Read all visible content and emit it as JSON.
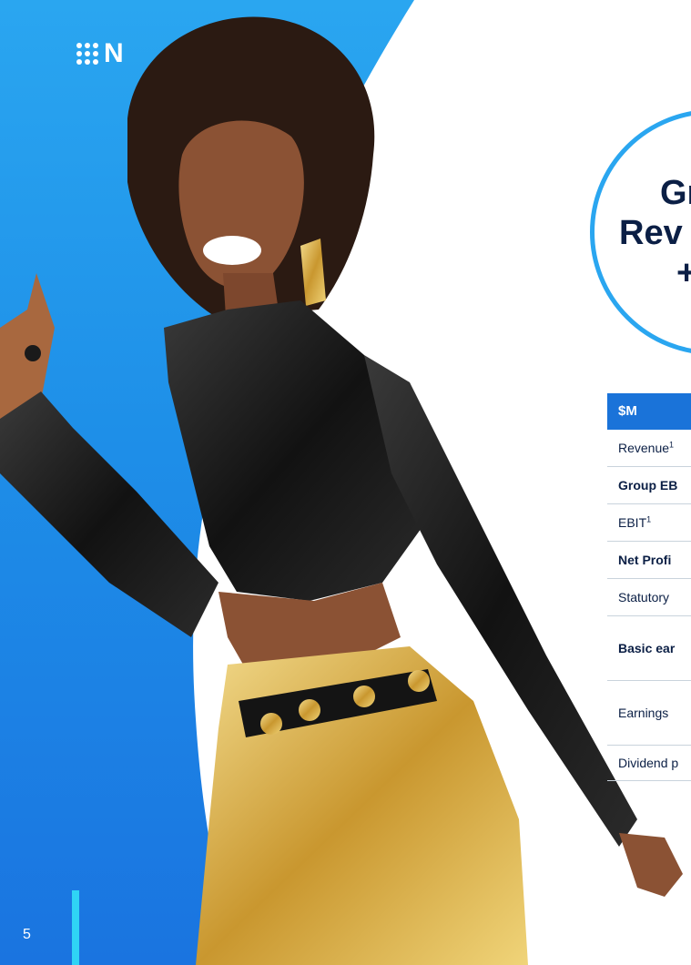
{
  "logo": {
    "text": "N",
    "icon": "nine-dots-logo-icon"
  },
  "callout": {
    "line1": "Gr",
    "line2": "Rev",
    "line3": "+"
  },
  "table": {
    "header": "$M",
    "rows": [
      {
        "label": "Revenue",
        "sup": "1",
        "bold": false
      },
      {
        "label": "Group EB",
        "sup": "",
        "bold": true
      },
      {
        "label": "EBIT",
        "sup": "1",
        "bold": false
      },
      {
        "label": "Net Profi",
        "sup": "",
        "bold": true
      },
      {
        "label": "Statutory",
        "sup": "",
        "bold": false
      },
      {
        "label": "Basic ear",
        "sup": "",
        "bold": true
      },
      {
        "label": "Earnings",
        "sup": "",
        "bold": false
      },
      {
        "label": "Dividend p",
        "sup": "",
        "bold": false
      }
    ]
  },
  "page": {
    "number": "5"
  },
  "colors": {
    "blue": "#1e8fe8",
    "navy": "#0b1f45",
    "table_header": "#1a73d9",
    "accent": "#2fd4f5",
    "gold": "#d9b25a"
  }
}
